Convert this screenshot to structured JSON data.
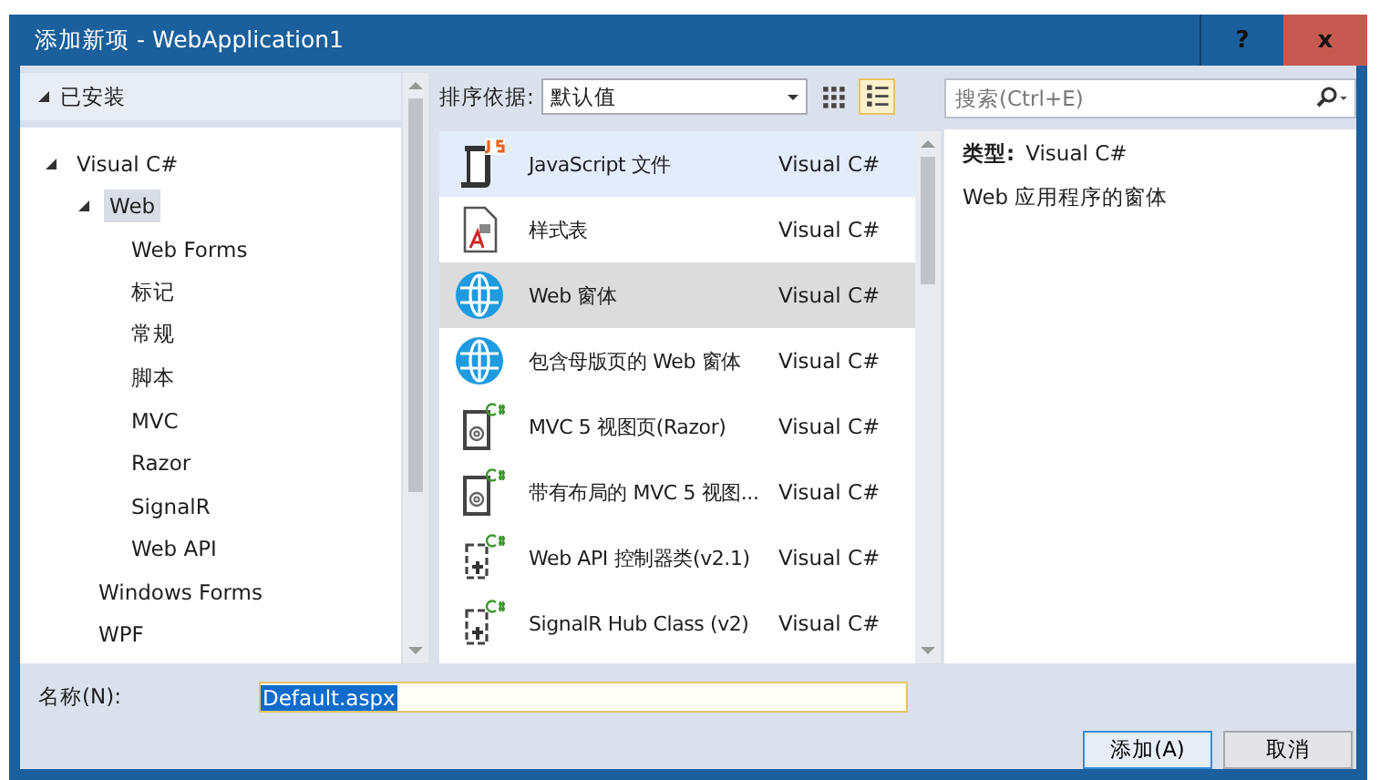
{
  "window": {
    "title": "添加新项 - WebApplication1",
    "help": "?",
    "close": "x"
  },
  "tree": {
    "header": "已安装",
    "header_expanded": true,
    "items": [
      {
        "label": "Visual C#",
        "expanded": true,
        "selected": false,
        "children": [
          {
            "label": "Web",
            "expanded": true,
            "selected": true,
            "children": [
              {
                "label": "Web Forms",
                "selected": false
              },
              {
                "label": "标记",
                "selected": false
              },
              {
                "label": "常规",
                "selected": false
              },
              {
                "label": "脚本",
                "selected": false
              },
              {
                "label": "MVC",
                "selected": false
              },
              {
                "label": "Razor",
                "selected": false
              },
              {
                "label": "SignalR",
                "selected": false
              },
              {
                "label": "Web API",
                "selected": false
              }
            ]
          },
          {
            "label": "Windows Forms",
            "selected": false
          },
          {
            "label": "WPF",
            "selected": false
          }
        ]
      }
    ]
  },
  "toolbar": {
    "sort_label": "排序依据:",
    "sort_value": "默认值",
    "view_buttons": [
      {
        "kind": "grid",
        "selected": false
      },
      {
        "kind": "list",
        "selected": true
      }
    ]
  },
  "search": {
    "placeholder": "搜索(Ctrl+E)"
  },
  "templates": [
    {
      "kind": "js",
      "name": "JavaScript 文件",
      "language": "Visual C#",
      "selected": false,
      "hovered": true
    },
    {
      "kind": "css",
      "name": "样式表",
      "language": "Visual C#",
      "selected": false,
      "hovered": false
    },
    {
      "kind": "globe",
      "name": "Web 窗体",
      "language": "Visual C#",
      "selected": true,
      "hovered": false
    },
    {
      "kind": "globe",
      "name": "包含母版页的 Web 窗体",
      "language": "Visual C#",
      "selected": false,
      "hovered": false
    },
    {
      "kind": "razor",
      "name": "MVC 5 视图页(Razor)",
      "language": "Visual C#",
      "selected": false,
      "hovered": false
    },
    {
      "kind": "razor",
      "name": "带有布局的 MVC 5 视图...",
      "language": "Visual C#",
      "selected": false,
      "hovered": false
    },
    {
      "kind": "api",
      "name": "Web API 控制器类(v2.1)",
      "language": "Visual C#",
      "selected": false,
      "hovered": false
    },
    {
      "kind": "api",
      "name": "SignalR Hub Class (v2)",
      "language": "Visual C#",
      "selected": false,
      "hovered": false
    }
  ],
  "details": {
    "type_label": "类型:",
    "type_value": "Visual C#",
    "description": "Web 应用程序的窗体"
  },
  "name_field": {
    "label": "名称(N):",
    "value": "Default.aspx"
  },
  "buttons": [
    {
      "label": "添加(A)",
      "default": true
    },
    {
      "label": "取消",
      "default": false
    }
  ]
}
